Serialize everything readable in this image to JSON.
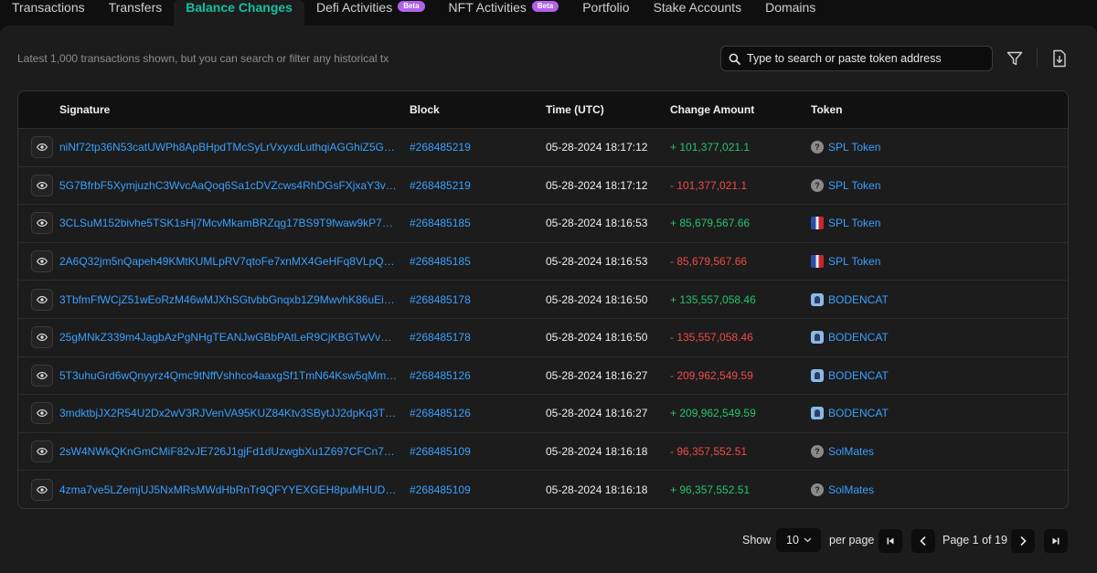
{
  "tabs": [
    {
      "label": "Transactions",
      "beta": ""
    },
    {
      "label": "Transfers",
      "beta": ""
    },
    {
      "label": "Balance Changes",
      "beta": ""
    },
    {
      "label": "Defi Activities",
      "beta": "Beta"
    },
    {
      "label": "NFT Activities",
      "beta": "Beta"
    },
    {
      "label": "Portfolio",
      "beta": ""
    },
    {
      "label": "Stake Accounts",
      "beta": ""
    },
    {
      "label": "Domains",
      "beta": ""
    }
  ],
  "active_tab": "Balance Changes",
  "info_text": "Latest 1,000 transactions shown, but you can search or filter any historical tx",
  "search": {
    "placeholder": "Type to search or paste token address"
  },
  "table": {
    "headers": [
      "Signature",
      "Block",
      "Time (UTC)",
      "Change Amount",
      "Token"
    ],
    "rows": [
      {
        "signature": "niNf72tp36N53catUWPh8ApBHpdTMcSyLrVxyxdLuthqiAGGhiZ5G6z...",
        "block": "#268485219",
        "time": "05-28-2024 18:17:12",
        "change": "+ 101,377,021.1",
        "sign": "pos",
        "token": "SPL Token",
        "token_icon": "unknown-token-icon"
      },
      {
        "signature": "5G7BfrbF5XymjuzhC3WvcAaQoq6Sa1cDVZcws4RhDGsFXjxaY3vqd...",
        "block": "#268485219",
        "time": "05-28-2024 18:17:12",
        "change": "- 101,377,021.1",
        "sign": "neg",
        "token": "SPL Token",
        "token_icon": "unknown-token-icon"
      },
      {
        "signature": "3CLSuM152bivhe5TSK1sHj7McvMkamBRZqg17BS9T9fwaw9kP73t...",
        "block": "#268485185",
        "time": "05-28-2024 18:16:53",
        "change": "+ 85,679,567.66",
        "sign": "pos",
        "token": "SPL Token",
        "token_icon": "flag-token-icon"
      },
      {
        "signature": "2A6Q32jm5nQapeh49KMtKUMLpRV7qtoFe7xnMX4GeHFq8VLpQFQ...",
        "block": "#268485185",
        "time": "05-28-2024 18:16:53",
        "change": "- 85,679,567.66",
        "sign": "neg",
        "token": "SPL Token",
        "token_icon": "flag-token-icon"
      },
      {
        "signature": "3TbfmFfWCjZ51wEoRzM46wMJXhSGtvbbGnqxb1Z9MwvhK86uEiA...",
        "block": "#268485178",
        "time": "05-28-2024 18:16:50",
        "change": "+ 135,557,058.46",
        "sign": "pos",
        "token": "BODENCAT",
        "token_icon": "bodencat-token-icon"
      },
      {
        "signature": "25gMNkZ339m4JagbAzPgNHgTEANJwGBbPAtLeR9CjKBGTwVvEiZ...",
        "block": "#268485178",
        "time": "05-28-2024 18:16:50",
        "change": "- 135,557,058.46",
        "sign": "neg",
        "token": "BODENCAT",
        "token_icon": "bodencat-token-icon"
      },
      {
        "signature": "5T3uhuGrd6wQnyyrz4Qmc9tNffVshhco4aaxgSf1TmN64Ksw5qMms...",
        "block": "#268485126",
        "time": "05-28-2024 18:16:27",
        "change": "- 209,962,549.59",
        "sign": "neg",
        "token": "BODENCAT",
        "token_icon": "bodencat-token-icon"
      },
      {
        "signature": "3mdktbjJX2R54U2Dx2wV3RJVenVA95KUZ84Ktv3SBytJJ2dpKq3TF...",
        "block": "#268485126",
        "time": "05-28-2024 18:16:27",
        "change": "+ 209,962,549.59",
        "sign": "pos",
        "token": "BODENCAT",
        "token_icon": "bodencat-token-icon"
      },
      {
        "signature": "2sW4NWkQKnGmCMiF82vJE726J1gjFd1dUzwgbXu1Z697CFCn7Fh...",
        "block": "#268485109",
        "time": "05-28-2024 18:16:18",
        "change": "- 96,357,552.51",
        "sign": "neg",
        "token": "SolMates",
        "token_icon": "unknown-token-icon"
      },
      {
        "signature": "4zma7ve5LZemjUJ5NxMRsMWdHbRnTr9QFYYEXGEH8puMHUDNV...",
        "block": "#268485109",
        "time": "05-28-2024 18:16:18",
        "change": "+ 96,357,552.51",
        "sign": "pos",
        "token": "SolMates",
        "token_icon": "unknown-token-icon"
      }
    ]
  },
  "pagination": {
    "show_label": "Show",
    "page_size": "10",
    "per_page_label": "per page",
    "page_info": "Page 1 of 19"
  },
  "colors": {
    "accent": "#14c0a0",
    "link": "#3aa0ff",
    "positive": "#26c46b",
    "negative": "#f04a4a",
    "beta": "#b063e8"
  }
}
